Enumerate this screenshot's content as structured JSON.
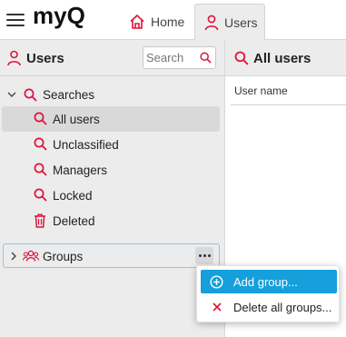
{
  "topbar": {
    "logo_text": "myQ",
    "tabs": [
      {
        "label": "Home",
        "icon": "home-icon"
      },
      {
        "label": "Users",
        "icon": "user-icon"
      }
    ]
  },
  "left_panel": {
    "title": "Users",
    "search": {
      "placeholder": "Search",
      "value": ""
    },
    "searches": {
      "label": "Searches",
      "items": [
        {
          "label": "All users",
          "icon": "search-icon",
          "selected": true
        },
        {
          "label": "Unclassified",
          "icon": "search-icon"
        },
        {
          "label": "Managers",
          "icon": "search-icon"
        },
        {
          "label": "Locked",
          "icon": "search-icon"
        },
        {
          "label": "Deleted",
          "icon": "trash-icon"
        }
      ]
    },
    "groups": {
      "label": "Groups",
      "icon": "users-group-icon",
      "more_icon": "more-icon"
    }
  },
  "right_panel": {
    "title": "All users",
    "column_header": "User name"
  },
  "context_menu": {
    "items": [
      {
        "label": "Add group...",
        "icon": "plus-circle-icon",
        "highlighted": true
      },
      {
        "label": "Delete all groups...",
        "icon": "x-icon"
      }
    ]
  },
  "colors": {
    "brand_red": "#e0123a",
    "highlight_blue": "#169fdb",
    "pane_gray": "#ececec",
    "selected_gray": "#d9d9d9",
    "focus_border": "#8fc3e8"
  }
}
